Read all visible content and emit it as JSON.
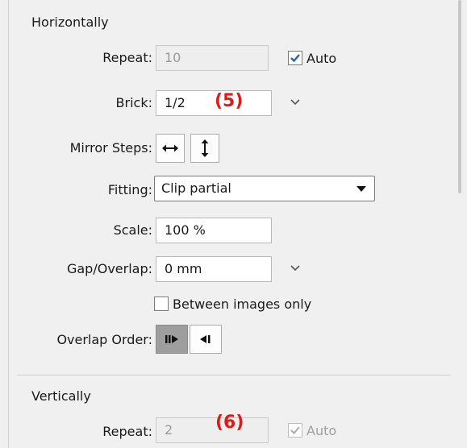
{
  "horizontally": {
    "title": "Horizontally",
    "repeat": {
      "label": "Repeat:",
      "value": "10",
      "auto_label": "Auto",
      "auto_checked": true
    },
    "brick": {
      "label": "Brick:",
      "value": "1/2"
    },
    "mirror_steps": {
      "label": "Mirror Steps:"
    },
    "fitting": {
      "label": "Fitting:",
      "value": "Clip partial"
    },
    "scale": {
      "label": "Scale:",
      "value": "100 %"
    },
    "gap": {
      "label": "Gap/Overlap:",
      "value": "0 mm"
    },
    "between_images": {
      "label": "Between images only",
      "checked": false
    },
    "overlap_order": {
      "label": "Overlap Order:"
    }
  },
  "vertically": {
    "title": "Vertically",
    "repeat": {
      "label": "Repeat:",
      "value": "2",
      "auto_label": "Auto",
      "auto_checked": true
    }
  },
  "callouts": {
    "five": "(5)",
    "six": "(6)"
  },
  "colors": {
    "callout": "#e01a1a",
    "check_blue": "#2b5fb3",
    "pressed": "#9e9e9e"
  },
  "icons": [
    "checkmark-icon",
    "chevron-down-icon",
    "horizontal-arrows-icon",
    "vertical-arrows-icon",
    "dropdown-arrow-icon",
    "overlap-left-icon",
    "overlap-right-icon"
  ]
}
